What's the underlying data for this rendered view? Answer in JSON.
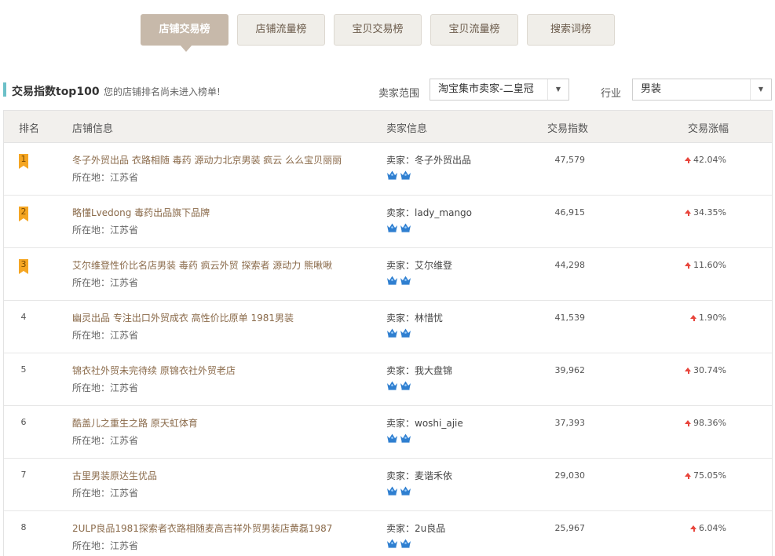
{
  "tabs": [
    {
      "label": "店铺交易榜",
      "active": true
    },
    {
      "label": "店铺流量榜",
      "active": false
    },
    {
      "label": "宝贝交易榜",
      "active": false
    },
    {
      "label": "宝贝流量榜",
      "active": false
    },
    {
      "label": "搜索词榜",
      "active": false
    }
  ],
  "section": {
    "title": "交易指数top100",
    "note": "您的店铺排名尚未进入榜单!",
    "seller_scope_label": "卖家范围",
    "seller_scope_value": "淘宝集市卖家-二皇冠",
    "industry_label": "行业",
    "industry_value": "男装"
  },
  "table": {
    "headers": {
      "rank": "排名",
      "shop": "店铺信息",
      "seller": "卖家信息",
      "index": "交易指数",
      "rise": "交易涨幅"
    },
    "rows": [
      {
        "rank": "1",
        "shop": "冬子外贸出品 衣路相随 毒药 源动力北京男装 疯云 么么宝贝丽丽",
        "location": "所在地：江苏省",
        "seller": "卖家：冬子外贸出品",
        "index": "47,579",
        "rise": "42.04%"
      },
      {
        "rank": "2",
        "shop": "略懂Lvedong 毒药出品旗下品牌",
        "location": "所在地：江苏省",
        "seller": "卖家：lady_mango",
        "index": "46,915",
        "rise": "34.35%"
      },
      {
        "rank": "3",
        "shop": "艾尔维登性价比名店男装 毒药 疯云外贸 探索者 源动力 熊啾啾",
        "location": "所在地：江苏省",
        "seller": "卖家：艾尔维登",
        "index": "44,298",
        "rise": "11.60%"
      },
      {
        "rank": "4",
        "shop": "幽灵出品 专注出口外贸成衣 高性价比原单 1981男装",
        "location": "所在地：江苏省",
        "seller": "卖家：林惜忧",
        "index": "41,539",
        "rise": "1.90%"
      },
      {
        "rank": "5",
        "shop": "锦衣社外贸未完待续 原锦衣社外贸老店",
        "location": "所在地：江苏省",
        "seller": "卖家：我大盘锦",
        "index": "39,962",
        "rise": "30.74%"
      },
      {
        "rank": "6",
        "shop": "酷盖儿之重生之路 原天虹体育",
        "location": "所在地：江苏省",
        "seller": "卖家：woshi_ajie",
        "index": "37,393",
        "rise": "98.36%"
      },
      {
        "rank": "7",
        "shop": "古里男装原达生优品",
        "location": "所在地：江苏省",
        "seller": "卖家：麦谐禾依",
        "index": "29,030",
        "rise": "75.05%"
      },
      {
        "rank": "8",
        "shop": "2ULP良品1981探索者衣路相随麦高吉祥外贸男装店黄磊1987",
        "location": "所在地：江苏省",
        "seller": "卖家：2u良品",
        "index": "25,967",
        "rise": "6.04%"
      }
    ]
  },
  "colors": {
    "accent": "#6cc0c8",
    "tab_active": "#c7b9aa",
    "rank_badge": "#f5a623",
    "rise_arrow": "#e8453c",
    "crown": "#2f7fd0"
  },
  "icons": {
    "crown": "crown-icon",
    "arrow": "arrow-up-icon",
    "caret": "caret-down-icon"
  }
}
